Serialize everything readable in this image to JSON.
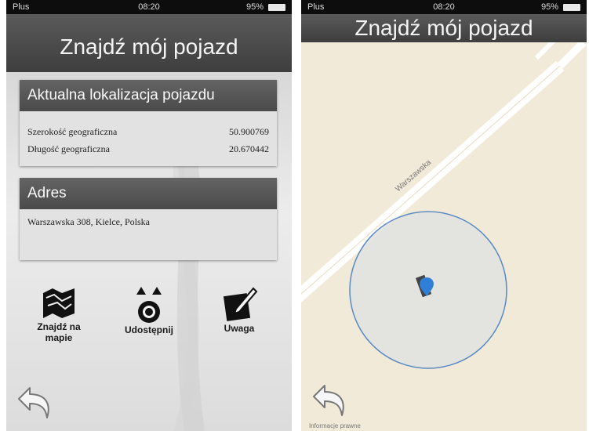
{
  "status_bar": {
    "carrier": "Plus",
    "time": "08:20",
    "battery": "95%"
  },
  "left_screen": {
    "title": "Znajdź mój pojazd",
    "location_card": {
      "header": "Aktualna lokalizacja pojazdu",
      "rows": [
        {
          "label": "Szerokość geograficzna",
          "value": "50.900769"
        },
        {
          "label": "Długość geograficzna",
          "value": "20.670442"
        }
      ]
    },
    "address_card": {
      "header": "Adres",
      "address": "Warszawska 308, Kielce, Polska"
    },
    "actions": [
      {
        "line1": "Znajdź na",
        "line2": "mapie",
        "icon": "map-icon"
      },
      {
        "line1": "Udostępnij",
        "line2": "",
        "icon": "share-icon"
      },
      {
        "line1": "Uwaga",
        "line2": "",
        "icon": "note-icon"
      }
    ]
  },
  "right_screen": {
    "title": "Znajdź mój pojazd",
    "street_label": "Warszawska",
    "credit": "Informacje prawne"
  }
}
